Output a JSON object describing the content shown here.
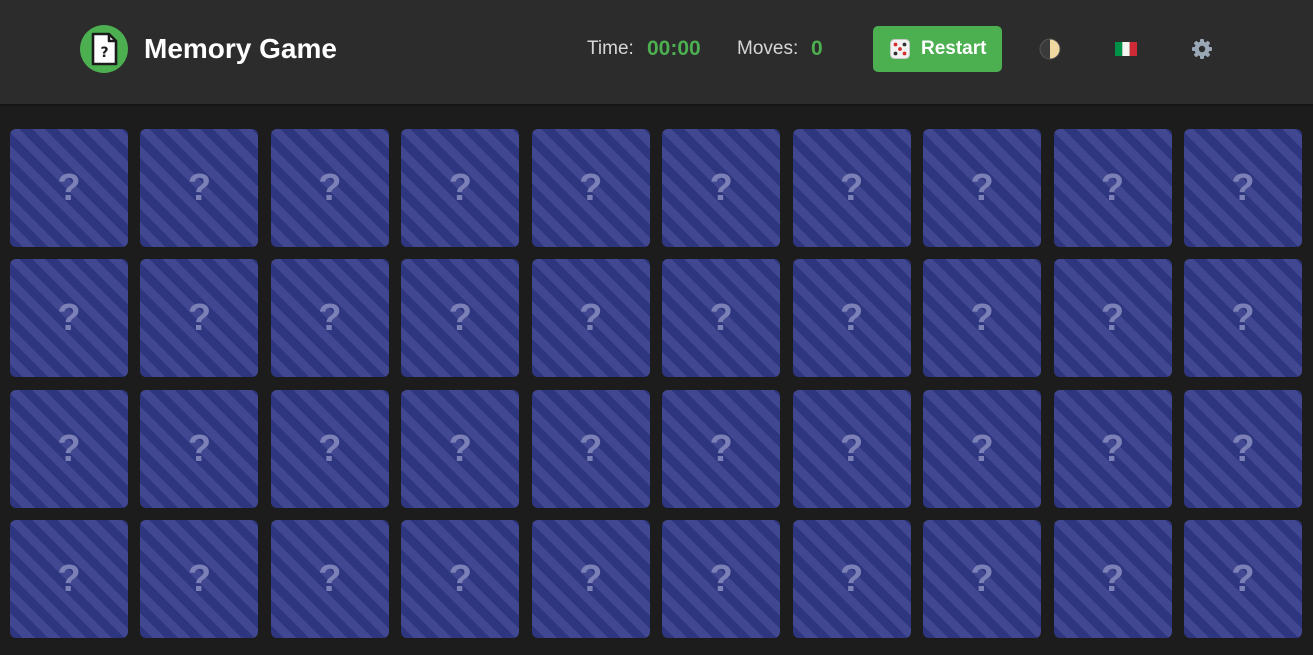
{
  "header": {
    "title": "Memory Game",
    "logo_icon": "question-file-icon",
    "time_label": "Time:",
    "time_value": "00:00",
    "moves_label": "Moves:",
    "moves_value": "0",
    "restart_label": "Restart",
    "restart_icon": "dice-icon",
    "theme_icon": "half-moon-icon",
    "language_icon": "italy-flag-icon",
    "settings_icon": "gear-icon"
  },
  "colors": {
    "accent": "#4caf50",
    "header_bg": "#2c2c2c",
    "board_bg": "#1c1c1c",
    "card_back": "#343a87",
    "card_stripe": "#414891",
    "card_mark": "#7b80b6"
  },
  "board": {
    "rows": 4,
    "columns": 10,
    "card_back_symbol": "?"
  }
}
